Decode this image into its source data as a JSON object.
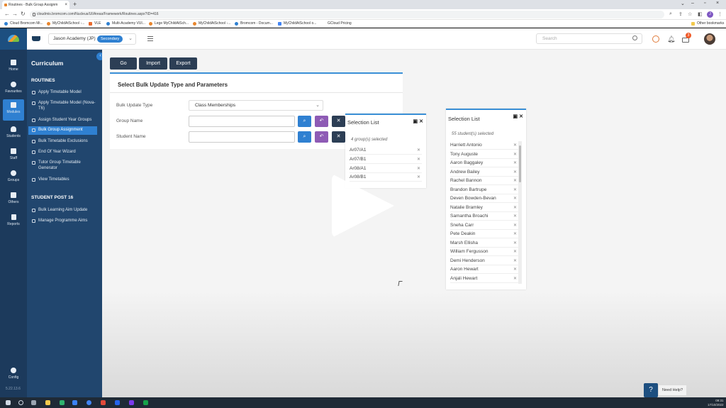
{
  "browser": {
    "tab_title": "Routines - Bulk Group Assignm",
    "url": "cloudmis.bromcom.com/Nucleus/UI/Areas/Framework/Routines.aspx?ID=416",
    "bookmarks": [
      "Cloud Bromcom Mi...",
      "MyChildAtSchool -...",
      "VLE",
      "Multi-Academy VUI...",
      "Lege MyChildAtSch...",
      "MyChildAtSchool -...",
      "Bromcom - Docum...",
      "MyChildAtSchool o...",
      "GCloud Pricing"
    ],
    "other_bookmarks": "Other bookmarks",
    "profile_initial": "J"
  },
  "header": {
    "school": "Jason Academy (JP)",
    "phase": "Secondary",
    "search_placeholder": "Search",
    "notification_count": "3"
  },
  "rail": {
    "items": [
      "Home",
      "Favourites",
      "Modules",
      "Students",
      "Staff",
      "Groups",
      "Others",
      "Reports"
    ],
    "config": "Config",
    "version": "5.22.13.6"
  },
  "sidebar": {
    "title": "Curriculum",
    "sections": [
      {
        "heading": "ROUTINES",
        "items": [
          "Apply Timetable Model",
          "Apply Timetable Model (Nova-T6)",
          "Assign Student Year Groups",
          "Bulk Group Assignment",
          "Bulk Timetable Exclusions",
          "End Of Year Wizard",
          "Tutor Group Timetable Generator",
          "View Timetables"
        ]
      },
      {
        "heading": "STUDENT POST 16",
        "items": [
          "Bulk Learning Aim Update",
          "Manage Programme Aims"
        ]
      }
    ]
  },
  "toolbar": {
    "go": "Go",
    "import": "Import",
    "export": "Export"
  },
  "form": {
    "title": "Select Bulk Update Type and Parameters",
    "update_type_label": "Bulk Update Type",
    "update_type_value": "Class Memberships",
    "group_name_label": "Group Name",
    "student_name_label": "Student Name"
  },
  "groups_list": {
    "title": "Selection List",
    "count_text": "4 group(s) selected",
    "items": [
      "Ar07/A1",
      "Ar07/B1",
      "Ar08/A1",
      "Ar08/B1"
    ]
  },
  "students_list": {
    "title": "Selection List",
    "count_text": "55 student(s) selected",
    "items": [
      "Harriett Antonio",
      "Tony Auguste",
      "Aaron Baggaley",
      "Andrew Bailey",
      "Rachel Bannon",
      "Brandon Bartrupe",
      "Deven Bowden-Bevan",
      "Natalie Bramley",
      "Samantha Broachi",
      "Sneha Carr",
      "Pete Deakin",
      "Marsh Ellisha",
      "William Fergusson",
      "Demi Henderson",
      "Aaron Hewart",
      "Anjali Hewart"
    ]
  },
  "help": {
    "icon": "?",
    "label": "Need Help?"
  },
  "taskbar": {
    "time": "09:31",
    "date": "17/10/2022"
  }
}
